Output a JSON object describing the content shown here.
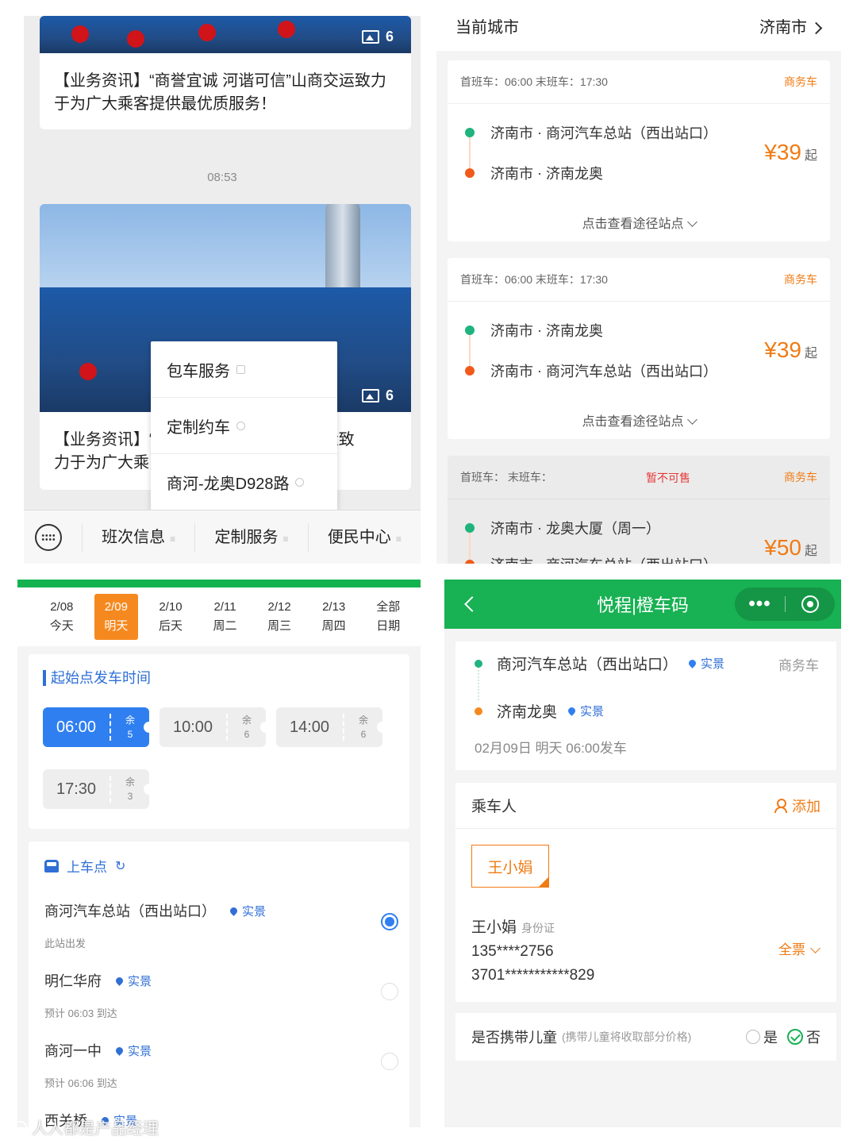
{
  "feed": {
    "card1": {
      "image_count": "6",
      "title": "【业务资讯】“商誉宜诚 河谐可信”山商交运致力于为广大乘客提供最优质服务！"
    },
    "timestamp": "08:53",
    "card2": {
      "image_count": "6",
      "title_left": "【业务资讯】“",
      "title_right": "商交运致",
      "title_line2": "力于为广大乘"
    },
    "popup_menu": [
      "包车服务",
      "定制约车",
      "商河-龙奥D928路"
    ],
    "menu_bar": [
      "班次信息",
      "定制服务",
      "便民中心"
    ]
  },
  "route_list": {
    "city_label": "当前城市",
    "city_value": "济南市",
    "routes": [
      {
        "times": "首班车：06:00 末班车：17:30",
        "tag": "商务车",
        "from_city": "济南市",
        "from": "商河汽车总站（西出站口）",
        "to_city": "济南市",
        "to": "济南龙奥",
        "price": "¥39",
        "price_suffix": "起",
        "view_stops": "点击查看途径站点"
      },
      {
        "times": "首班车：06:00 末班车：17:30",
        "tag": "商务车",
        "from_city": "济南市",
        "from": "济南龙奥",
        "to_city": "济南市",
        "to": "商河汽车总站（西出站口）",
        "price": "¥39",
        "price_suffix": "起",
        "view_stops": "点击查看途径站点"
      },
      {
        "times": "首班车： 末班车：",
        "status": "暂不可售",
        "tag": "商务车",
        "from_city": "济南市",
        "from": "龙奥大厦（周一）",
        "to_city": "济南市",
        "to": "商河汽车总站（西出站口）",
        "price": "¥50",
        "price_suffix": "起"
      }
    ]
  },
  "schedule": {
    "dates": [
      {
        "date": "2/08",
        "label": "今天"
      },
      {
        "date": "2/09",
        "label": "明天"
      },
      {
        "date": "2/10",
        "label": "后天"
      },
      {
        "date": "2/11",
        "label": "周二"
      },
      {
        "date": "2/12",
        "label": "周三"
      },
      {
        "date": "2/13",
        "label": "周四"
      },
      {
        "date": "全部",
        "label": "日期"
      }
    ],
    "section_title": "起始点发车时间",
    "slots": [
      {
        "time": "06:00",
        "left_label": "余",
        "left": "5"
      },
      {
        "time": "10:00",
        "left_label": "余",
        "left": "6"
      },
      {
        "time": "14:00",
        "left_label": "余",
        "left": "6"
      },
      {
        "time": "17:30",
        "left_label": "余",
        "left": "3"
      }
    ],
    "boarding_title": "上车点",
    "stops": [
      {
        "name": "商河汽车总站（西出站口）",
        "tag": "实景",
        "sub": "此站出发"
      },
      {
        "name": "明仁华府",
        "tag": "实景",
        "sub": "预计 06:03 到达"
      },
      {
        "name": "商河一中",
        "tag": "实景",
        "sub": "预计 06:06 到达"
      },
      {
        "name": "西关桥",
        "tag": "实景"
      }
    ]
  },
  "order": {
    "app_title": "悦程|橙车码",
    "capsule_more": "•••",
    "from": "商河汽车总站（西出站口）",
    "from_tag": "实景",
    "to": "济南龙奥",
    "to_tag": "实景",
    "vehicle_tag": "商务车",
    "depart": "02月09日 明天 06:00发车",
    "passenger_label": "乘车人",
    "add_label": "添加",
    "chip_name": "王小娟",
    "pax_name": "王小娟",
    "pax_id_type": "身份证",
    "pax_phone": "135****2756",
    "pax_id": "3701***********829",
    "ticket_type": "全票",
    "child_label": "是否携带儿童",
    "child_hint": "(携带儿童将收取部分价格)",
    "child_yes": "是",
    "child_no": "否"
  },
  "watermark": "人人都是产品经理"
}
